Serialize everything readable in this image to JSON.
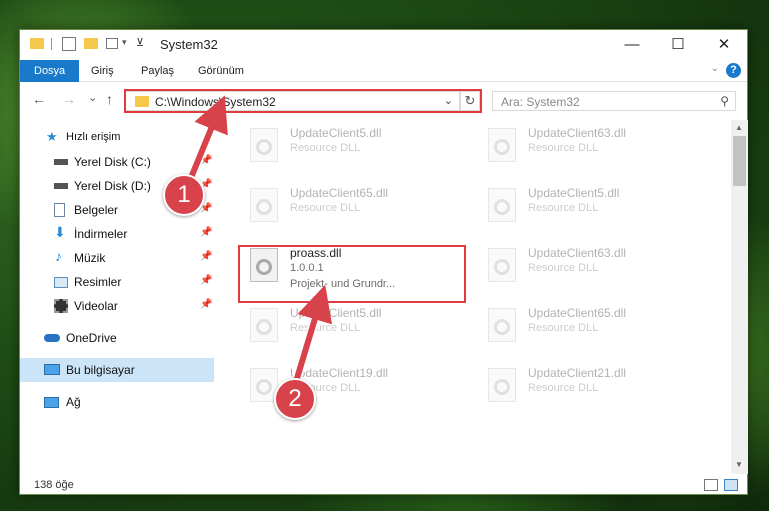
{
  "window": {
    "title": "System32",
    "minimize": "—",
    "maximize": "☐",
    "close": "✕"
  },
  "ribbon": {
    "tabs": [
      "Dosya",
      "Giriş",
      "Paylaş",
      "Görünüm"
    ],
    "help": "?"
  },
  "navigation": {
    "back": "←",
    "forward": "→",
    "recent": "⌄",
    "up": "↑",
    "address": "C:\\Windows\\System32",
    "refresh": "↻",
    "search_placeholder": "Ara: System32"
  },
  "sidebar": {
    "quick_access": "Hızlı erişim",
    "items": [
      {
        "label": "Yerel Disk (C:)",
        "icon": "drive-icon"
      },
      {
        "label": "Yerel Disk (D:)",
        "icon": "drive-icon"
      },
      {
        "label": "Belgeler",
        "icon": "documents-icon"
      },
      {
        "label": "İndirmeler",
        "icon": "download-icon"
      },
      {
        "label": "Müzik",
        "icon": "music-icon"
      },
      {
        "label": "Resimler",
        "icon": "pictures-icon"
      },
      {
        "label": "Videolar",
        "icon": "video-icon"
      }
    ],
    "onedrive": "OneDrive",
    "this_pc": "Bu bilgisayar",
    "network": "Ağ"
  },
  "files": [
    {
      "name": "UpdateClient5.dll",
      "desc": "Resource DLL"
    },
    {
      "name": "UpdateClient63.dll",
      "desc": "Resource DLL"
    },
    {
      "name": "UpdateClient65.dll",
      "desc": "Resource DLL"
    },
    {
      "name": "UpdateClient5.dll",
      "desc": "Resource DLL"
    },
    {
      "name": "UpdateClient63.dll",
      "desc": "Resource DLL"
    },
    {
      "name": "UpdateClient5.dll",
      "desc": "Resource DLL"
    },
    {
      "name": "UpdateClient65.dll",
      "desc": "Resource DLL"
    },
    {
      "name": "UpdateClient19.dll",
      "desc": "Resource DLL"
    },
    {
      "name": "UpdateClient21.dll",
      "desc": "Resource DLL"
    }
  ],
  "highlighted_file": {
    "name": "proass.dll",
    "version": "1.0.0.1",
    "desc": "Projekt- und Grundr..."
  },
  "status": {
    "count": "138 öğe"
  },
  "annotations": {
    "step1": "1",
    "step2": "2"
  },
  "colors": {
    "accent": "#1979ca",
    "highlight": "#e0393e",
    "badge": "#d8424a"
  }
}
